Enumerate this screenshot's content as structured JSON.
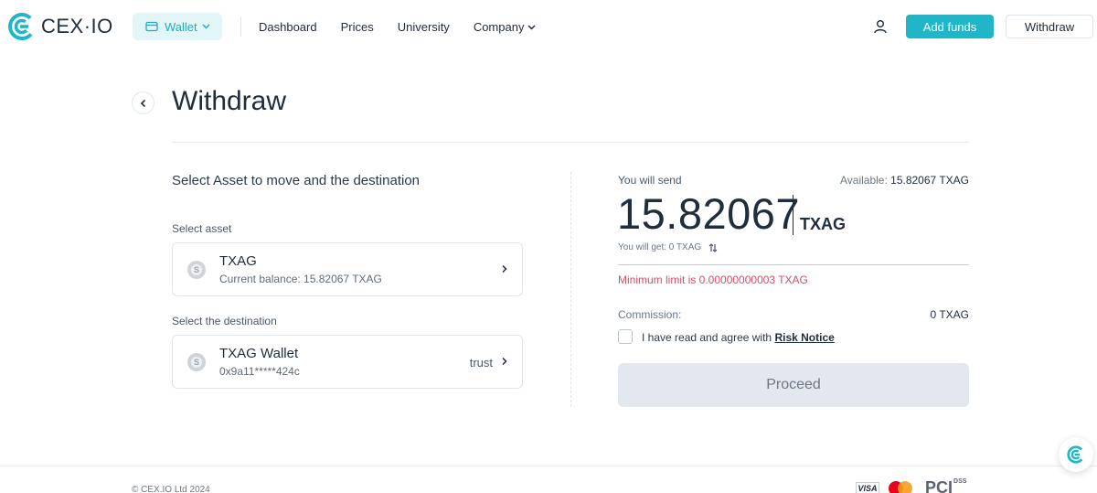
{
  "header": {
    "logo_text": "CEX·IO",
    "wallet_label": "Wallet",
    "nav": [
      "Dashboard",
      "Prices",
      "University",
      "Company"
    ],
    "add_funds_label": "Add funds",
    "withdraw_label": "Withdraw"
  },
  "page": {
    "title": "Withdraw"
  },
  "left": {
    "heading": "Select Asset to move and the destination",
    "asset_label": "Select asset",
    "asset": {
      "name": "TXAG",
      "balance": "Current balance: 15.82067 TXAG"
    },
    "destination_label": "Select the destination",
    "destination": {
      "name": "TXAG Wallet",
      "address": "0x9a11*****424c",
      "tag": "trust"
    }
  },
  "right": {
    "send_label": "You will send",
    "available_label": "Available:",
    "available_value": "15.82067 TXAG",
    "amount": "15.82067",
    "amount_unit": "TXAG",
    "will_get": "You will get: 0 TXAG",
    "min_limit": "Minimum limit is 0.00000000003 TXAG",
    "commission_label": "Commission:",
    "commission_value": "0 TXAG",
    "agree_text": "I have read and agree with",
    "risk_notice": "Risk Notice",
    "proceed_label": "Proceed"
  },
  "footer": {
    "copyright": "© CEX.IO Ltd 2024",
    "visa": "VISA",
    "pci": "PCI",
    "pci_small": "DSS"
  },
  "colors": {
    "accent": "#20b6c8",
    "error": "#d0506a",
    "disabled_button": "#e3e8ee"
  }
}
